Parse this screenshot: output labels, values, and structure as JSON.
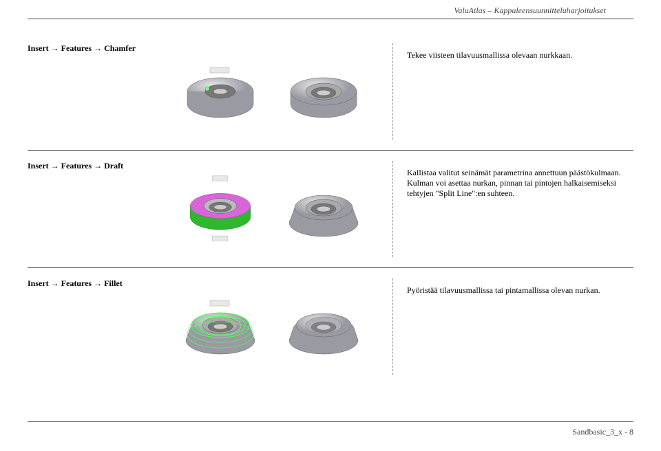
{
  "header": "ValuAtlas – Kappaleensuunnitteluharjoitukset",
  "rows": [
    {
      "command": "Insert → Features → Chamfer",
      "desc": "Tekee viisteen tilavuusmallissa olevaan nurkkaan."
    },
    {
      "command": "Insert → Features → Draft",
      "desc": "Kallistaa valitut seinämät parametrina annettuun päästökulmaan. Kulman voi asettaa nurkan, pinnan tai pintojen halkaisemiseksi tehtyjen \"Split Line\":en suhteen."
    },
    {
      "command": "Insert → Features → Fillet",
      "desc": "Pyöristää tilavuusmallissa tai pintamallissa olevan nurkan."
    }
  ],
  "footer": "Sandbasic_3_x - 8"
}
